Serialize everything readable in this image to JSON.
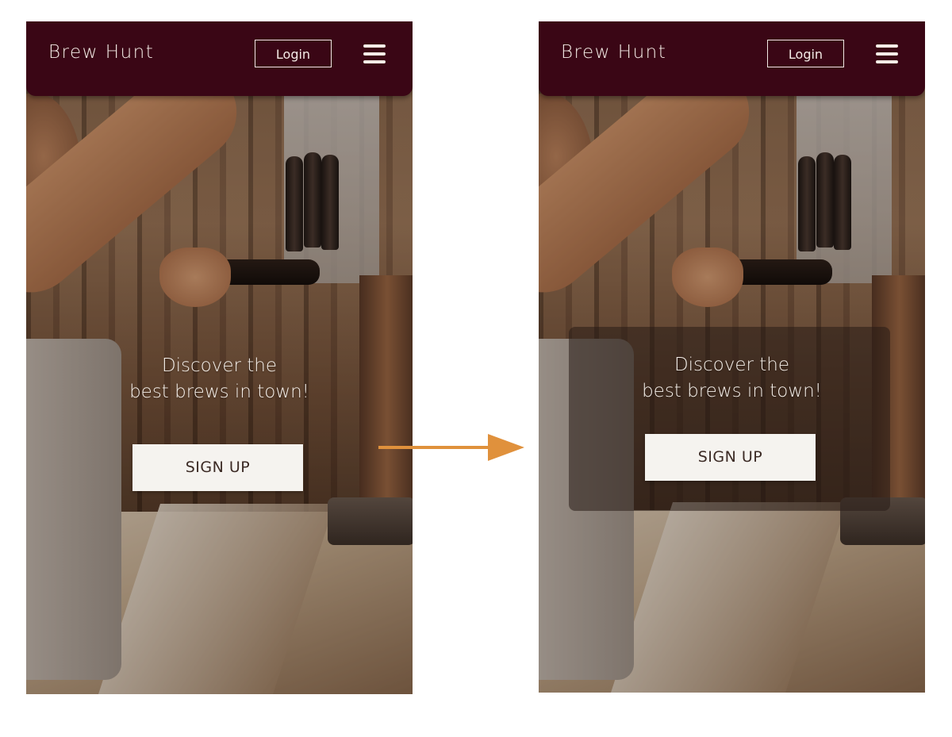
{
  "app": {
    "brand": "Brew Hunt",
    "login_label": "Login",
    "menu_icon": "hamburger-icon"
  },
  "hero": {
    "line1": "Discover the",
    "line2": "best brews in town!",
    "signup_label": "SIGN UP"
  },
  "colors": {
    "header_bg": "#3a0615",
    "button_bg": "#f5f3ef",
    "arrow": "#e0913c",
    "panel_overlay": "rgba(40,28,22,0.55)"
  },
  "comparison": {
    "before": "without-text-panel",
    "after": "with-translucent-text-panel",
    "arrow_icon": "right-arrow-icon"
  }
}
